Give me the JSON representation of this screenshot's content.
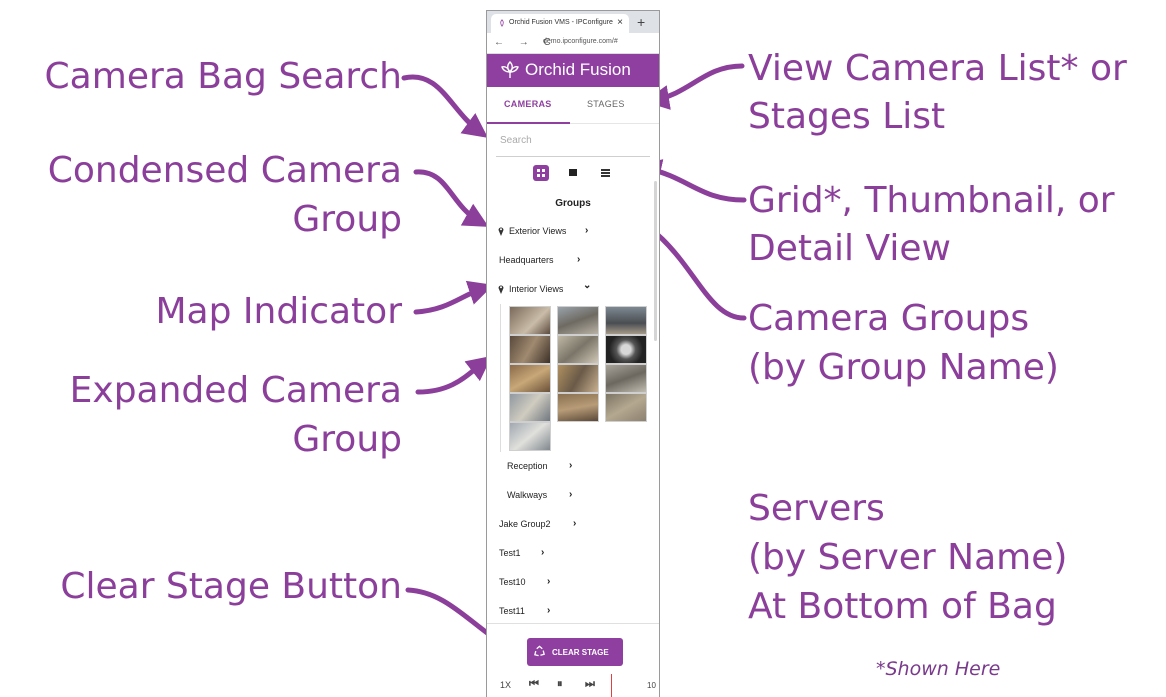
{
  "callouts": {
    "camera_bag_search": "Camera Bag Search",
    "condensed_group_line1": "Condensed Camera",
    "condensed_group_line2": "Group",
    "map_indicator": "Map Indicator",
    "expanded_group_line1": "Expanded Camera",
    "expanded_group_line2": "Group",
    "clear_stage_button": "Clear Stage Button",
    "view_list_line1": "View Camera List* or",
    "view_list_line2": "Stages List",
    "grid_view_line1": "Grid*, Thumbnail, or",
    "grid_view_line2": "Detail View",
    "camera_groups_line1": "Camera Groups",
    "camera_groups_line2": "(by Group Name)",
    "servers_line1": "Servers",
    "servers_line2": "(by Server Name)",
    "servers_line3": "At Bottom of Bag",
    "shown_here": "*Shown Here"
  },
  "browser": {
    "tab_title": "Orchid Fusion VMS - IPConfigure",
    "tab_close": "×",
    "new_tab": "+",
    "nav_glyphs": "← → C",
    "url": "demo.ipconfigure.com/#"
  },
  "app": {
    "brand": "Orchid Fusion",
    "tab_cameras": "CAMERAS",
    "tab_stages": "STAGES",
    "search_placeholder": "Search",
    "groups_heading": "Groups",
    "groups": [
      {
        "label": "Exterior Views",
        "chevron": "›"
      },
      {
        "label": "Headquarters",
        "chevron": "›"
      },
      {
        "label": "Interior Views",
        "chevron": "⌄"
      },
      {
        "label": "Reception",
        "chevron": "›"
      },
      {
        "label": "Walkways",
        "chevron": "›"
      },
      {
        "label": "Jake Group2",
        "chevron": "›"
      },
      {
        "label": "Test1",
        "chevron": "›"
      },
      {
        "label": "Test10",
        "chevron": "›"
      },
      {
        "label": "Test11",
        "chevron": "›"
      }
    ],
    "clear_stage_label": "CLEAR STAGE",
    "playback_speed": "1X",
    "timeline_value": "10"
  },
  "colors": {
    "accent": "#8e3fa0",
    "callout_text": "#8b3f9b"
  }
}
